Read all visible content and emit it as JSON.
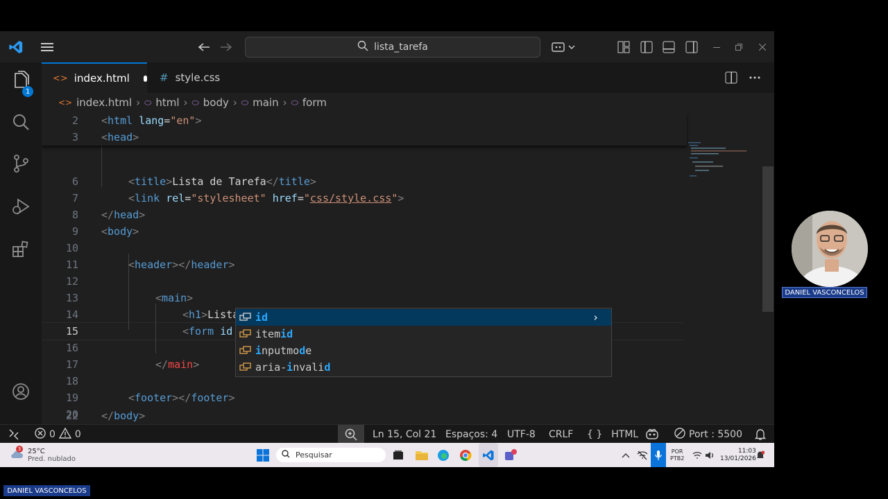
{
  "titlebar": {
    "search_text": "lista_tarefa",
    "icons": [
      "vscode-logo-icon",
      "menu-icon",
      "back-arrow-icon",
      "forward-arrow-icon",
      "copilot-icon",
      "layout-icon",
      "toggle-sidebar-icon",
      "toggle-panel-icon",
      "toggle-secondary-sidebar-icon",
      "minimize-icon",
      "restore-icon",
      "close-icon"
    ]
  },
  "activity": {
    "explorer_badge": "1"
  },
  "tabs": [
    {
      "label": "index.html",
      "modified": true
    },
    {
      "label": "style.css"
    }
  ],
  "breadcrumb": [
    "index.html",
    "html",
    "body",
    "main",
    "form"
  ],
  "editor": {
    "sticky": [
      {
        "n": "2",
        "text": "<html lang=\"en\">"
      },
      {
        "n": "3",
        "text": "<head>"
      }
    ],
    "lines": [
      {
        "n": "6",
        "text": "<title>Lista de Tarefa</title>"
      },
      {
        "n": "7",
        "text": "<link rel=\"stylesheet\" href=\"css/style.css\">"
      },
      {
        "n": "8",
        "text": "</head>"
      },
      {
        "n": "9",
        "text": "<body>"
      },
      {
        "n": "10",
        "text": ""
      },
      {
        "n": "11",
        "text": "<header></header>"
      },
      {
        "n": "12",
        "text": ""
      },
      {
        "n": "13",
        "text": "<main>"
      },
      {
        "n": "14",
        "text": "<h1>Lista de Tarefas</h1>"
      },
      {
        "n": "15",
        "text": "<form id"
      },
      {
        "n": "16",
        "text": ""
      },
      {
        "n": "17",
        "text": "</main>"
      },
      {
        "n": "18",
        "text": ""
      },
      {
        "n": "19",
        "text": "<footer></footer>"
      },
      {
        "n": "20",
        "text": ""
      },
      {
        "n": "21",
        "text": ""
      },
      {
        "n": "22",
        "text": "</body>"
      }
    ]
  },
  "suggestions": [
    "id",
    "itemid",
    "inputmode",
    "aria-invalid"
  ],
  "status": {
    "errors": "0",
    "warnings": "0",
    "position": "Ln 15, Col 21",
    "spaces": "Espaços: 4",
    "encoding": "UTF-8",
    "eol": "CRLF",
    "language": "HTML",
    "port": "Port : 5500"
  },
  "taskbar": {
    "weather_temp": "25°C",
    "weather_desc": "Pred. nublado",
    "weather_badge": "3",
    "search_placeholder": "Pesquisar",
    "lang_top": "POR",
    "lang_bottom": "PTB2",
    "time": "11:03",
    "date": "13/01/2026"
  },
  "webcam": {
    "name": "DANIEL VASCONCELOS"
  },
  "overlay_label": "DANIEL VASCONCELOS",
  "colors": {
    "accent": "#0078d4",
    "tag": "#569cd6",
    "attr": "#9cdcfe",
    "string": "#ce9178",
    "selection": "#04395e"
  }
}
